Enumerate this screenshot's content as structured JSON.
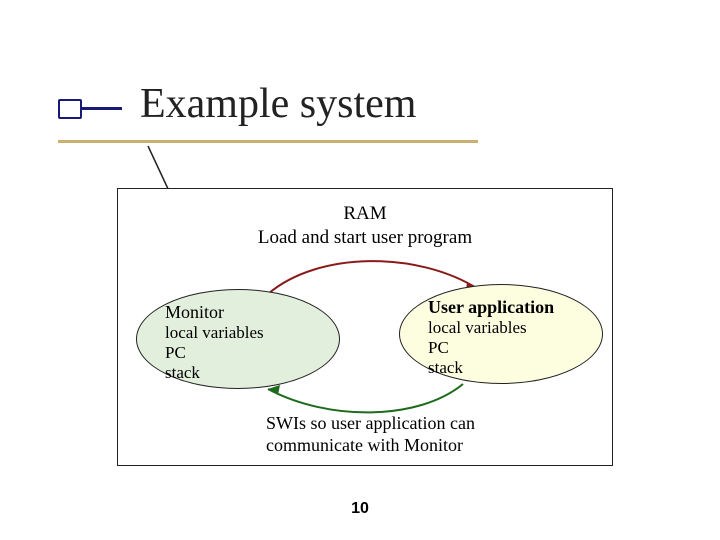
{
  "title": "Example system",
  "diagram": {
    "ram": "RAM",
    "load": "Load and start user program",
    "monitor": {
      "heading": "Monitor",
      "line1": "local variables",
      "line2": "PC",
      "line3": "stack"
    },
    "user": {
      "heading": "User application",
      "line1": "local variables",
      "line2": "PC",
      "line3": "stack"
    },
    "swi": "SWIs so user application can communicate with Monitor"
  },
  "page": "10"
}
